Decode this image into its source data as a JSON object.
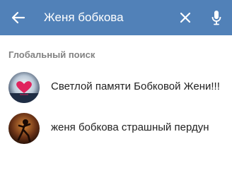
{
  "header": {
    "background_color": "#5181b8",
    "back_icon": "arrow-left-icon",
    "search": {
      "value": "Женя бобкова",
      "placeholder": ""
    },
    "clear_icon": "close-icon",
    "voice_icon": "microphone-icon"
  },
  "section": {
    "title": "Глобальный поиск"
  },
  "results": [
    {
      "title": "Светлой памяти Бобковой Жени!!!",
      "avatar_icon": "heart-avatar"
    },
    {
      "title": "женя бобкова страшный пердун",
      "avatar_icon": "person-avatar"
    }
  ]
}
